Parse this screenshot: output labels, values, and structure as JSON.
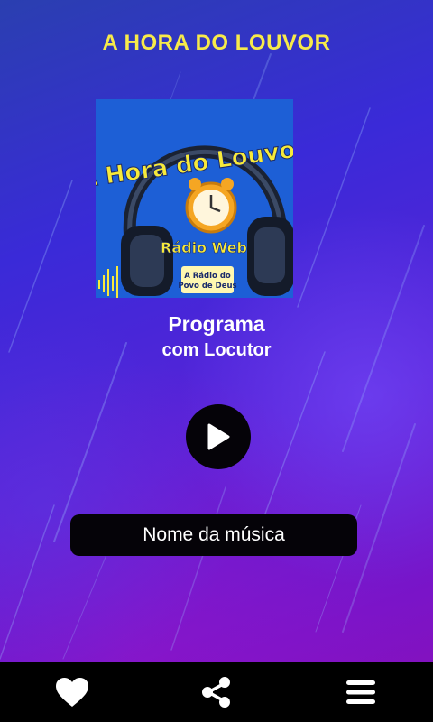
{
  "header": {
    "title": "A HORA DO LOUVOR"
  },
  "cover": {
    "brand_name": "A Hora do Louvor",
    "tagline": "Rádio Web",
    "slogan_line1": "A Rádio do",
    "slogan_line2": "Povo de Deus",
    "colors": {
      "background": "#1d5fd6",
      "brand_text": "#f7ea3a",
      "clock": "#f5a623"
    }
  },
  "program": {
    "title": "Programa",
    "subtitle": "com Locutor"
  },
  "player": {
    "play_icon": "play-icon",
    "song_name": "Nome da música"
  },
  "bottom_nav": {
    "items": [
      {
        "icon": "heart-icon",
        "label": ""
      },
      {
        "icon": "share-icon",
        "label": ""
      },
      {
        "icon": "menu-icon",
        "label": ""
      }
    ]
  },
  "colors": {
    "title": "#f7ea4a",
    "accent_dark": "#050308",
    "background_start": "#2a3fb0",
    "background_end": "#8a10b8"
  }
}
